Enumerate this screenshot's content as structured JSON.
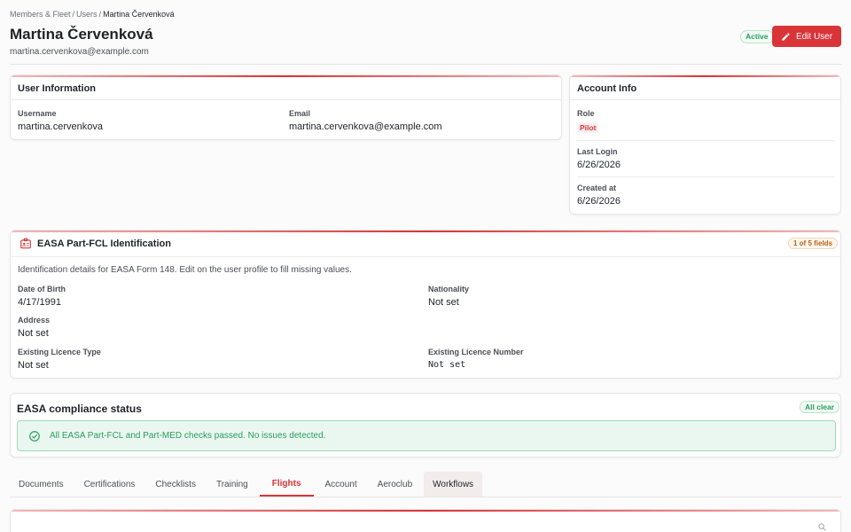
{
  "breadcrumb": {
    "items": [
      "Members & Fleet",
      "Users"
    ],
    "current": "Martina Červenková",
    "separator": "/"
  },
  "header": {
    "title": "Martina Červenková",
    "email": "martina.cervenkova@example.com",
    "status_badge": "Active",
    "edit_button": "Edit User"
  },
  "user_info": {
    "title": "User Information",
    "username_label": "Username",
    "username": "martina.cervenkova",
    "email_label": "Email",
    "email": "martina.cervenkova@example.com"
  },
  "account_info": {
    "title": "Account Info",
    "role_label": "Role",
    "role": "Pilot",
    "last_login_label": "Last Login",
    "last_login": "6/26/2026",
    "created_label": "Created at",
    "created": "6/26/2026"
  },
  "easa_id": {
    "title": "EASA Part-FCL Identification",
    "fields_badge": "1 of 5 fields",
    "description": "Identification details for EASA Form 148. Edit on the user profile to fill missing values.",
    "dob_label": "Date of Birth",
    "dob": "4/17/1991",
    "nationality_label": "Nationality",
    "nationality": "Not set",
    "address_label": "Address",
    "address": "Not set",
    "licence_type_label": "Existing Licence Type",
    "licence_type": "Not set",
    "licence_number_label": "Existing Licence Number",
    "licence_number": "Not set"
  },
  "compliance": {
    "title": "EASA compliance status",
    "badge": "All clear",
    "message": "All EASA Part-FCL and Part-MED checks passed. No issues detected."
  },
  "tabs": {
    "documents": "Documents",
    "certifications": "Certifications",
    "checklists": "Checklists",
    "training": "Training",
    "flights": "Flights",
    "account": "Account",
    "aeroclub": "Aeroclub",
    "workflows": "Workflows"
  },
  "colors": {
    "accent": "#d93438",
    "success": "#2a9d5c",
    "warning": "#b5651d"
  },
  "icons": {
    "edit": "pencil-icon",
    "id_card": "id-card-icon",
    "check": "check-circle-icon",
    "search": "search-icon"
  }
}
